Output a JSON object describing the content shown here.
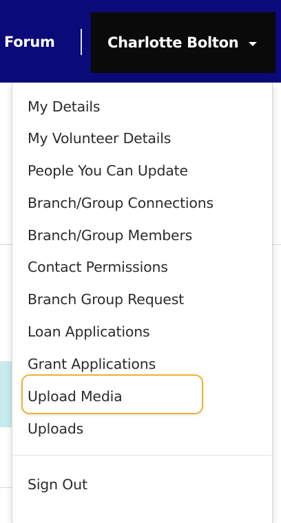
{
  "navbar": {
    "forum_label": "Forum",
    "user_name": "Charlotte Bolton",
    "colors": {
      "navbar_bg": "#0a0a78",
      "user_toggle_bg": "#0a0a0a",
      "text": "#ffffff"
    }
  },
  "dropdown": {
    "items": [
      {
        "label": "My Details"
      },
      {
        "label": "My Volunteer Details"
      },
      {
        "label": "People You Can Update"
      },
      {
        "label": "Branch/Group Connections"
      },
      {
        "label": "Branch/Group Members"
      },
      {
        "label": "Contact Permissions"
      },
      {
        "label": "Branch Group Request"
      },
      {
        "label": "Loan Applications"
      },
      {
        "label": "Grant Applications"
      },
      {
        "label": "Upload Media",
        "highlighted": true
      },
      {
        "label": "Uploads"
      }
    ],
    "sign_out_label": "Sign Out",
    "highlight_color": "#f0b12e"
  },
  "icons": {
    "caret": "chevron-down-icon"
  }
}
